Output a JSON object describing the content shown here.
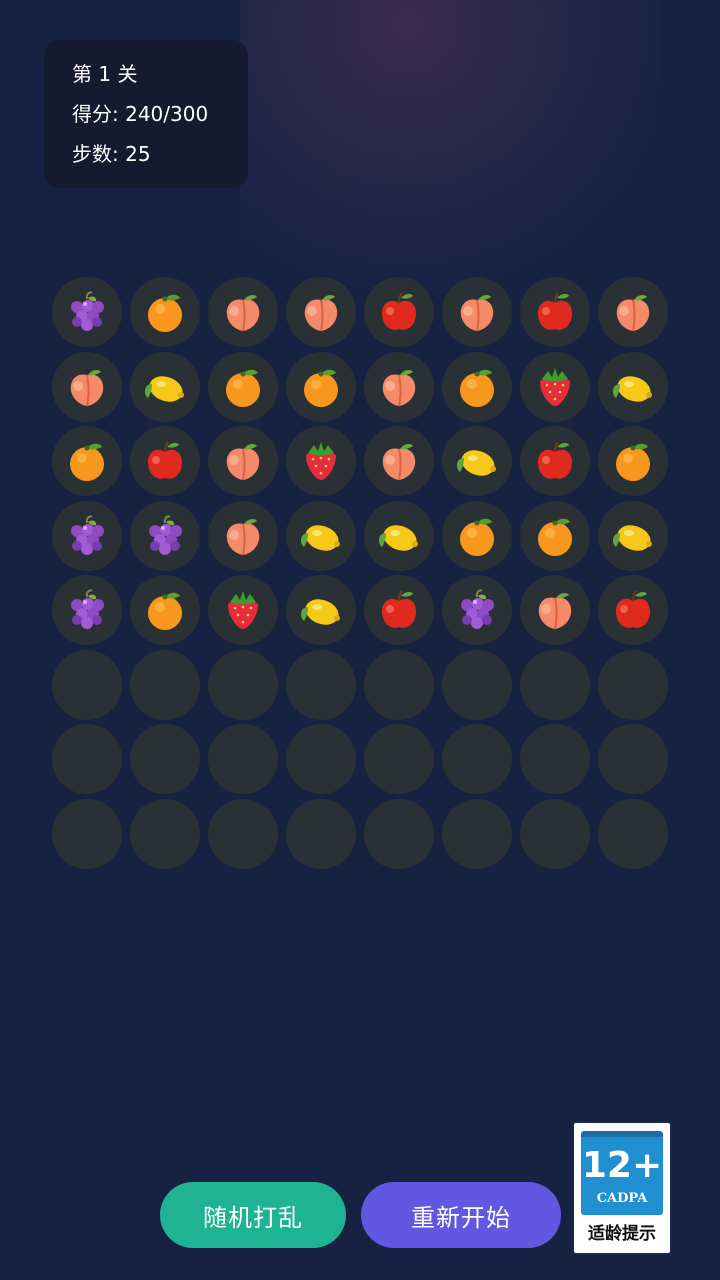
{
  "hud": {
    "level": "第 1 关",
    "score": "得分: 240/300",
    "steps": "步数: 25"
  },
  "board": {
    "columns": 8,
    "rows": 8,
    "grid": [
      [
        "grape",
        "orange",
        "peach",
        "peach",
        "apple",
        "peach",
        "apple",
        "peach"
      ],
      [
        "peach",
        "lemon",
        "orange",
        "orange",
        "peach",
        "orange",
        "strawberry",
        "lemon"
      ],
      [
        "orange",
        "apple",
        "peach",
        "strawberry",
        "peach",
        "lemon",
        "apple",
        "orange"
      ],
      [
        "grape",
        "grape",
        "peach",
        "lemon",
        "lemon",
        "orange",
        "orange",
        "lemon"
      ],
      [
        "grape",
        "orange",
        "strawberry",
        "lemon",
        "apple",
        "grape",
        "peach",
        "apple"
      ],
      [
        "",
        "",
        "",
        "",
        "",
        "",
        "",
        ""
      ],
      [
        "",
        "",
        "",
        "",
        "",
        "",
        "",
        ""
      ],
      [
        "",
        "",
        "",
        "",
        "",
        "",
        "",
        ""
      ]
    ]
  },
  "buttons": {
    "shuffle_label": "随机打乱",
    "restart_label": "重新开始"
  },
  "age_rating": {
    "rating": "12+",
    "org": "CADPA",
    "tip": "适龄提示"
  },
  "colors": {
    "background": "#172242",
    "cell": "#2a3134",
    "shuffle_button": "#1fb394",
    "restart_button": "#6257e0",
    "rating_blue": "#1f8fd0"
  }
}
